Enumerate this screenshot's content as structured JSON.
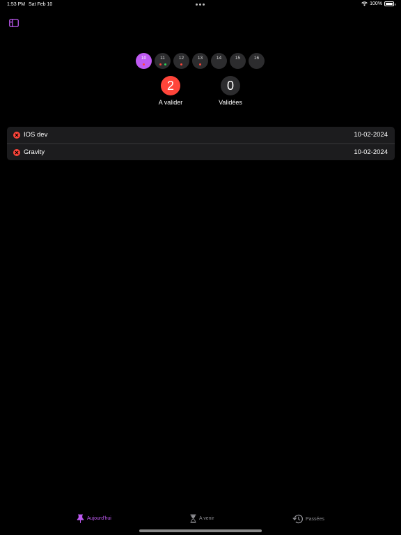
{
  "status_bar": {
    "time": "1:53 PM",
    "date": "Sat Feb 10",
    "battery": "100%"
  },
  "header": {
    "sidebar_icon": "sidebar-toggle-icon"
  },
  "accent_color": "#bf5af2",
  "days": [
    {
      "number": "10",
      "selected": true,
      "dots": [
        "#ff453a"
      ]
    },
    {
      "number": "11",
      "selected": false,
      "dots": [
        "#ff453a",
        "#30d158"
      ]
    },
    {
      "number": "12",
      "selected": false,
      "dots": [
        "#ff453a"
      ]
    },
    {
      "number": "13",
      "selected": false,
      "dots": [
        "#ff453a"
      ]
    },
    {
      "number": "14",
      "selected": false,
      "dots": []
    },
    {
      "number": "15",
      "selected": false,
      "dots": []
    },
    {
      "number": "16",
      "selected": false,
      "dots": []
    }
  ],
  "counters": {
    "to_validate": {
      "count": "2",
      "label": "A valider",
      "color": "#ff453a"
    },
    "validated": {
      "count": "0",
      "label": "Validées",
      "color": "#2c2c2e"
    }
  },
  "tasks": [
    {
      "name": "IOS dev",
      "date": "10-02-2024",
      "status_icon": "x-circle-icon",
      "status_color": "#ff453a"
    },
    {
      "name": "Gravity",
      "date": "10-02-2024",
      "status_icon": "x-circle-icon",
      "status_color": "#ff453a"
    }
  ],
  "tabs": [
    {
      "label": "Aujourd'hui",
      "icon": "pin-icon",
      "active": true
    },
    {
      "label": "A venir",
      "icon": "hourglass-icon",
      "active": false
    },
    {
      "label": "Passées",
      "icon": "history-icon",
      "active": false
    }
  ]
}
